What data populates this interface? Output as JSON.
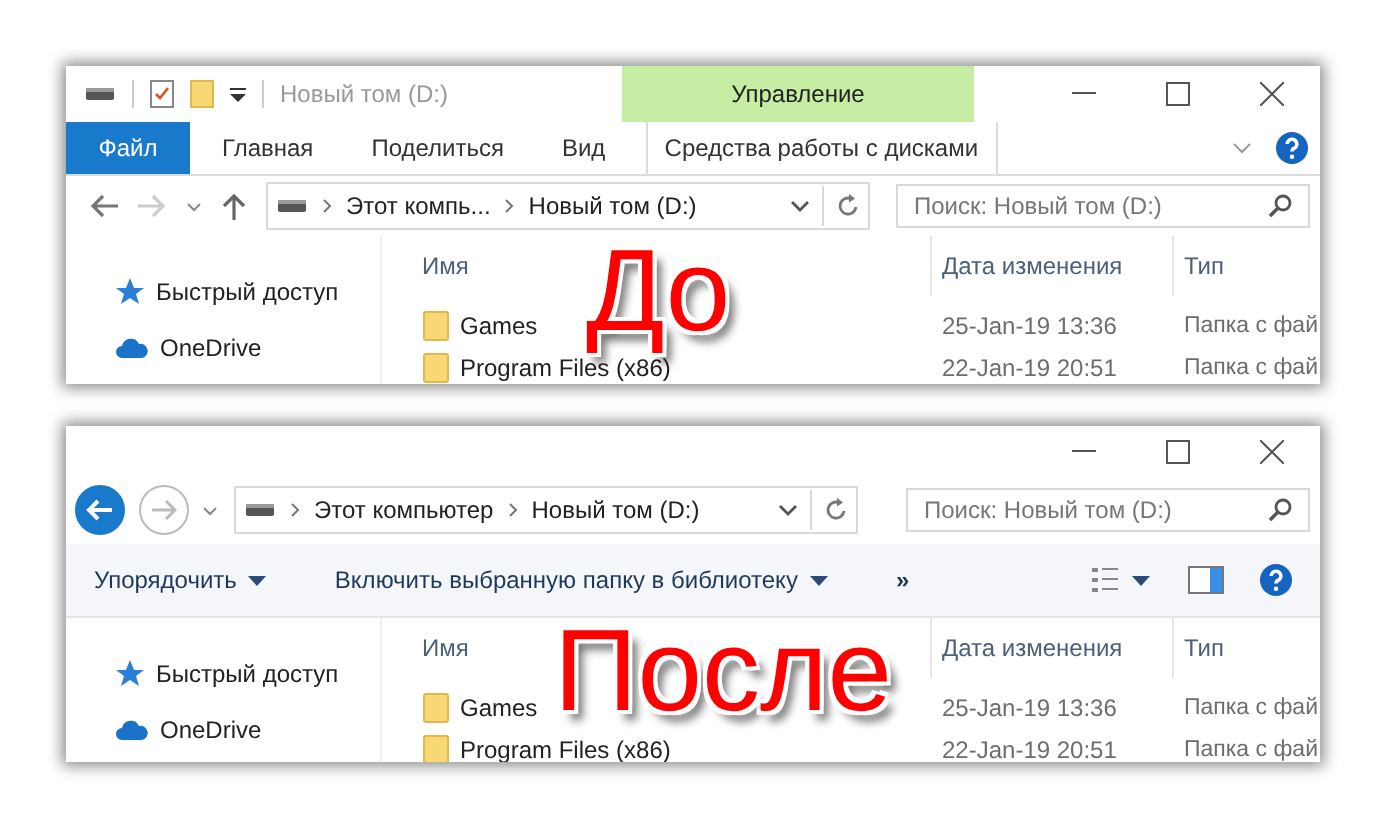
{
  "panels": [
    {
      "kind": "ribbon",
      "title": "Новый том (D:)",
      "context_group": "Управление",
      "tabs": [
        {
          "label": "Файл",
          "kind": "file",
          "selected": false
        },
        {
          "label": "Главная",
          "kind": "normal",
          "selected": false
        },
        {
          "label": "Поделиться",
          "kind": "normal",
          "selected": false
        },
        {
          "label": "Вид",
          "kind": "normal",
          "selected": false
        },
        {
          "label": "Средства работы с дисками",
          "kind": "context",
          "selected": false
        }
      ],
      "nav": {
        "back_disabled": false,
        "forward_disabled": true
      },
      "breadcrumbs": [
        "Этот компь...",
        "Новый том (D:)"
      ],
      "search": {
        "placeholder": "Поиск: Новый том (D:)"
      },
      "sidebar": [
        {
          "label": "Быстрый доступ",
          "kind": "star"
        },
        {
          "label": "OneDrive",
          "kind": "cloud"
        }
      ],
      "columns": [
        "Имя",
        "Дата изменения",
        "Тип"
      ],
      "rows": [
        {
          "name": "Games",
          "date": "25-Jan-19 13:36",
          "type": "Папка с фай"
        },
        {
          "name": "Program Files (x86)",
          "date": "22-Jan-19 20:51",
          "type": "Папка с фай"
        }
      ],
      "caption": "До"
    },
    {
      "kind": "classic",
      "nav": {
        "back_disabled": false,
        "forward_disabled": true
      },
      "breadcrumbs": [
        "Этот компьютер",
        "Новый том (D:)"
      ],
      "search": {
        "placeholder": "Поиск: Новый том (D:)"
      },
      "toolbar": [
        {
          "label": "Упорядочить",
          "kind": "menu"
        },
        {
          "label": "Включить выбранную папку в библиотеку",
          "kind": "menu"
        },
        {
          "label": "»",
          "kind": "more"
        }
      ],
      "sidebar": [
        {
          "label": "Быстрый доступ",
          "kind": "star"
        },
        {
          "label": "OneDrive",
          "kind": "cloud"
        }
      ],
      "columns": [
        "Имя",
        "Дата изменения",
        "Тип"
      ],
      "rows": [
        {
          "name": "Games",
          "date": "25-Jan-19 13:36",
          "type": "Папка с фай"
        },
        {
          "name": "Program Files (x86)",
          "date": "22-Jan-19 20:51",
          "type": "Папка с фай"
        }
      ],
      "caption": "После"
    }
  ]
}
